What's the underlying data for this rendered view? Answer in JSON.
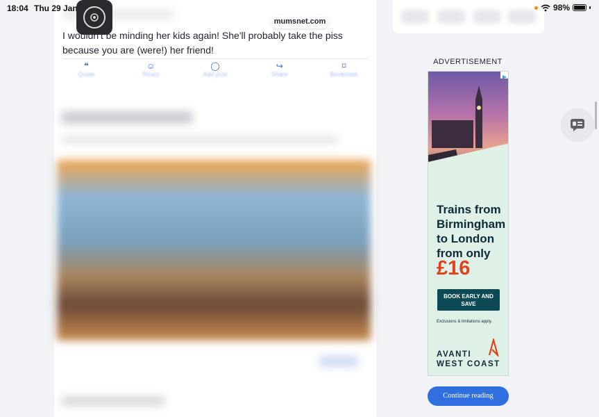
{
  "status_bar": {
    "time": "18:04",
    "date": "Thu 29 Jan",
    "battery": "98%"
  },
  "browser": {
    "url": "mumsnet.com"
  },
  "post": {
    "text": "I wouldn't be minding her kids again! She'll probably take the piss because you are (were!) her friend!",
    "actions": [
      {
        "label": "Quote",
        "icon": "quote-icon"
      },
      {
        "label": "React",
        "icon": "react-icon"
      },
      {
        "label": "Add post",
        "icon": "comment-icon"
      },
      {
        "label": "Share",
        "icon": "share-icon"
      },
      {
        "label": "Bookmark",
        "icon": "bookmark-icon"
      }
    ]
  },
  "sidebar": {
    "ad_label": "ADVERTISEMENT",
    "continue_label": "Continue reading"
  },
  "ad": {
    "headline": "Trains from Birmingham to London from only",
    "price": "£16",
    "cta": "BOOK EARLY AND SAVE",
    "disclaimer": "Exclusions & limitations apply.",
    "brand_line1": "AVANTI",
    "brand_line2": "WEST COAST"
  },
  "colors": {
    "accent": "#2f6fe0",
    "ad_bg": "#dff1e6",
    "ad_price": "#e0421e",
    "ad_button": "#0c4a55"
  }
}
